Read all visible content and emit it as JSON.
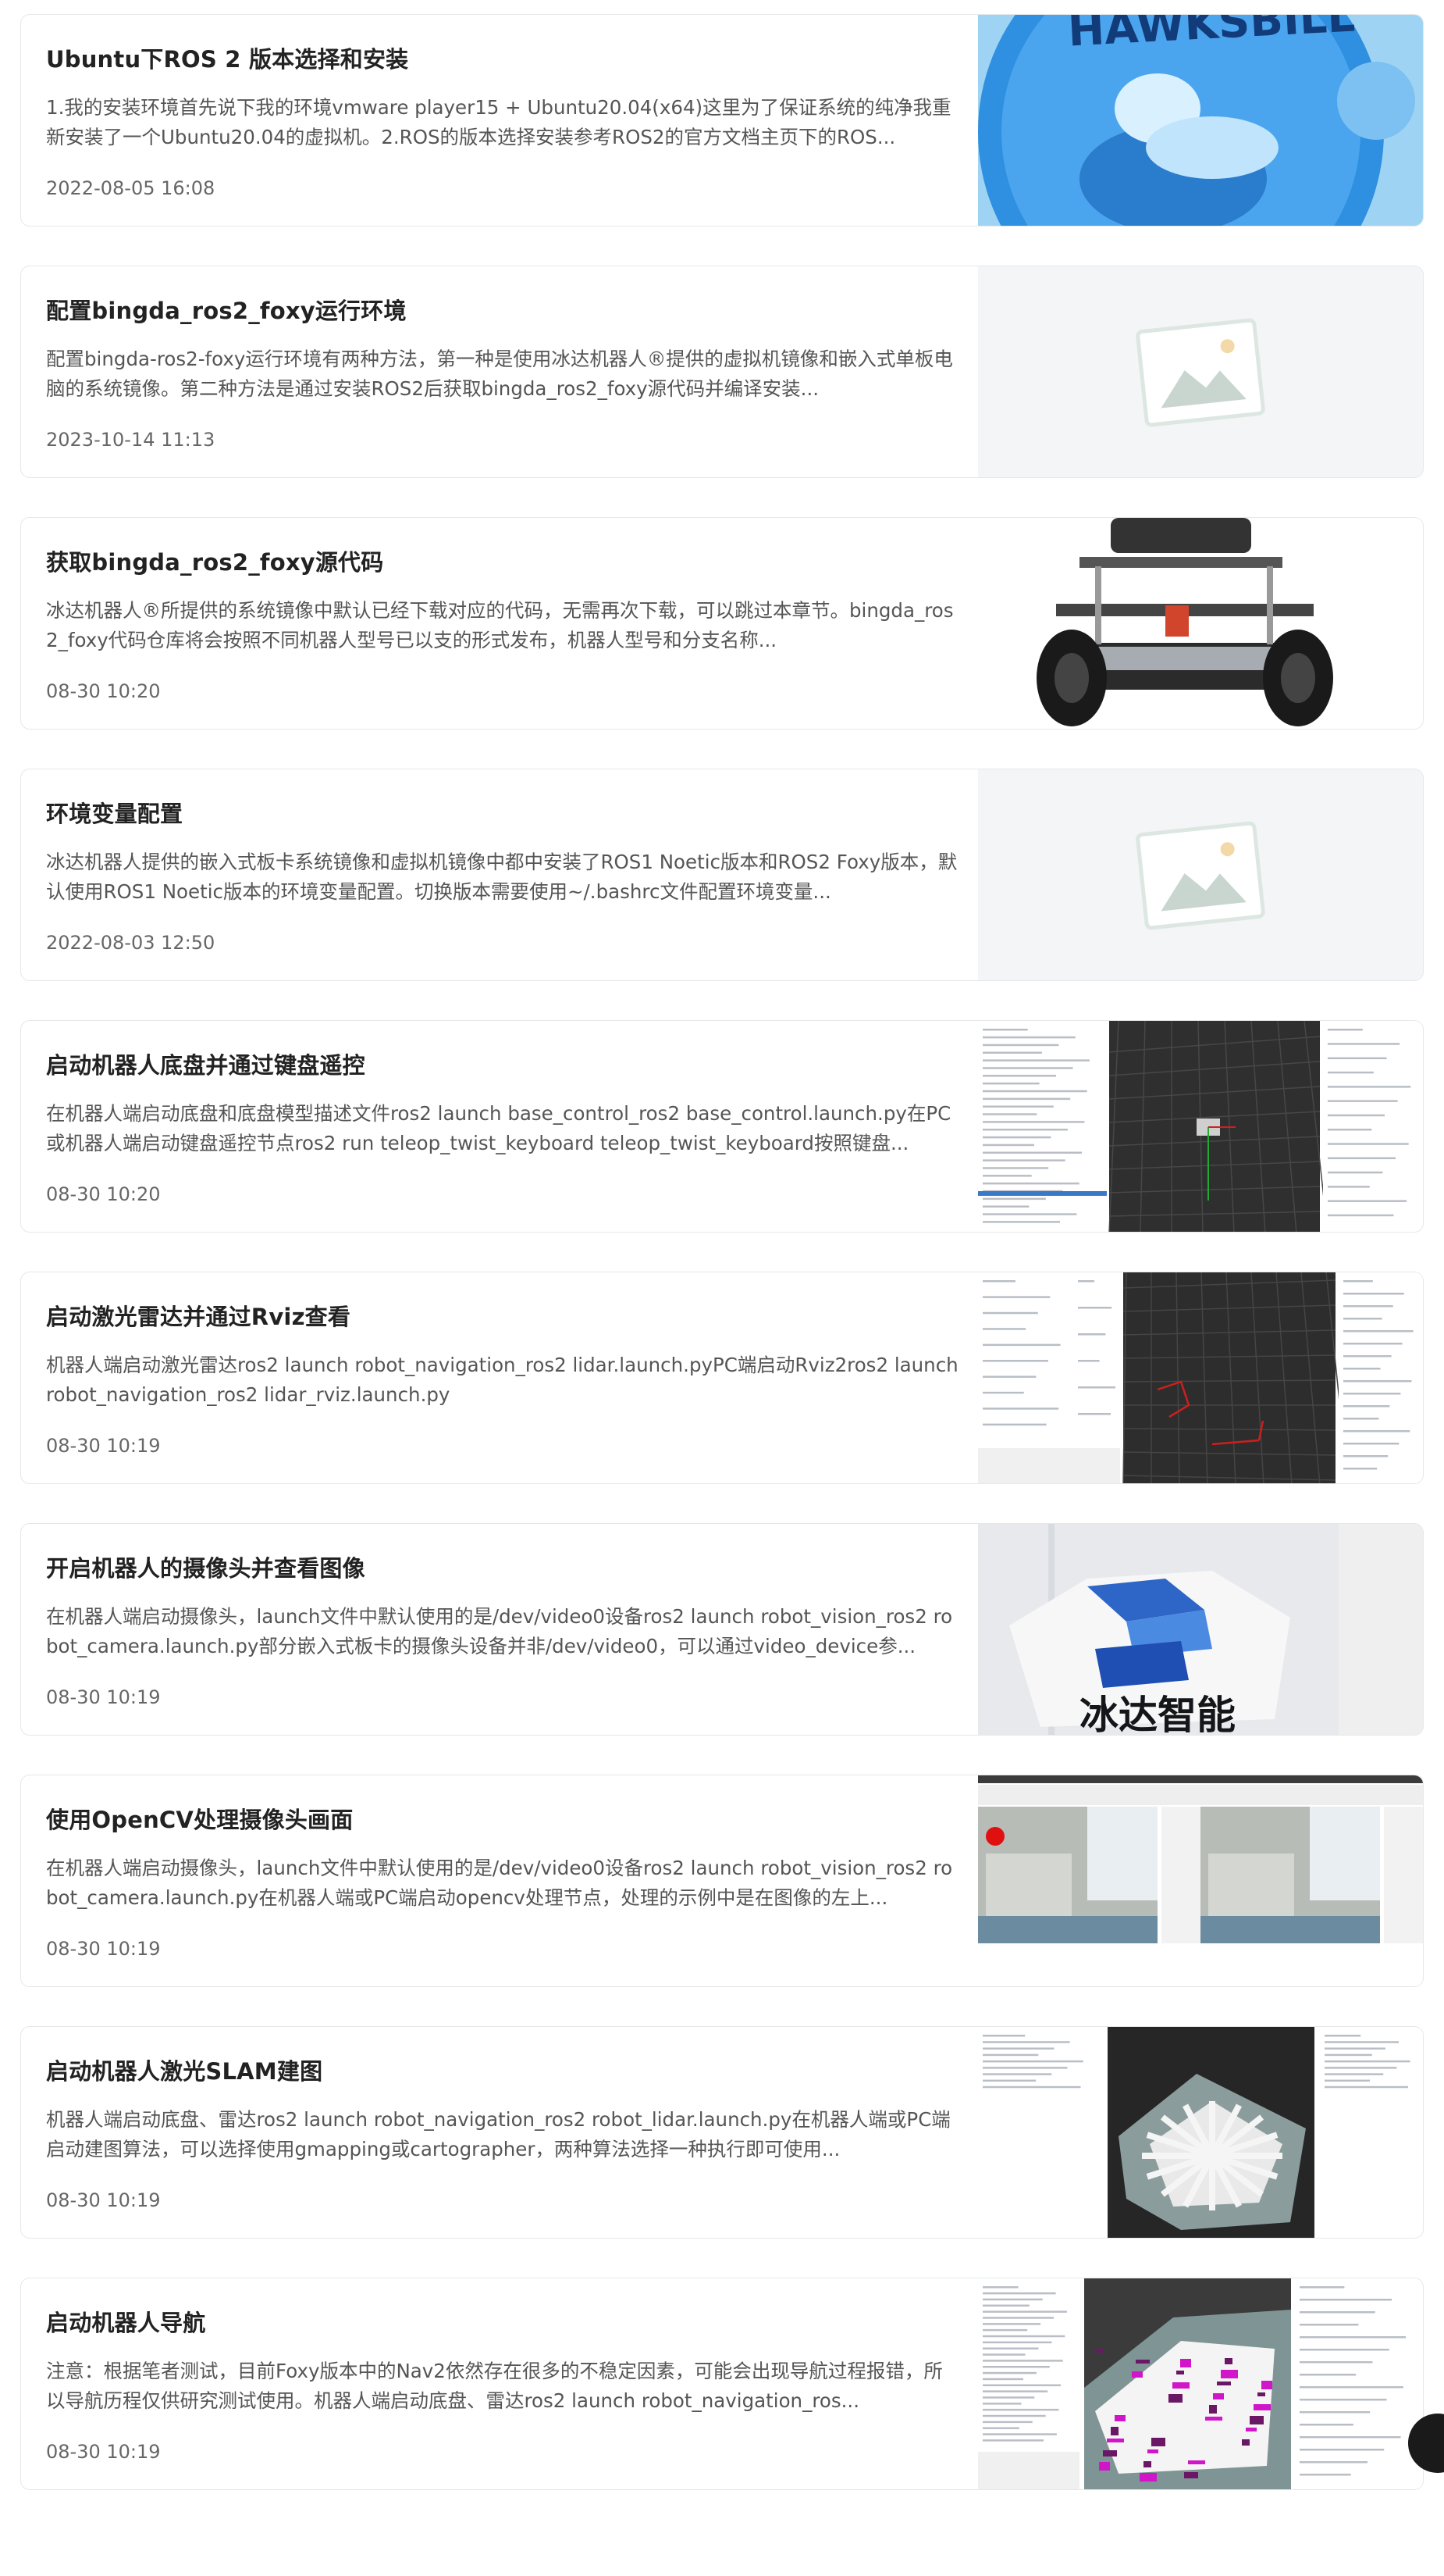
{
  "articles": [
    {
      "title": "Ubuntu下ROS 2 版本选择和安装",
      "desc": "1.我的安装环境首先说下我的环境vmware player15 + Ubuntu20.04(x64)这里为了保证系统的纯净我重新安装了一个Ubuntu20.04的虚拟机。2.ROS的版本选择安装参考ROS2的官方文档主页下的ROS...",
      "date": "2022-08-05 16:08",
      "thumb": "hawksbill",
      "thumb_text": "HAWKSBILL"
    },
    {
      "title": "配置bingda_ros2_foxy运行环境",
      "desc": "配置bingda-ros2-foxy运行环境有两种方法，第一种是使用冰达机器人®提供的虚拟机镜像和嵌入式单板电脑的系统镜像。第二种方法是通过安装ROS2后获取bingda_ros2_foxy源代码并编译安装...",
      "date": "2023-10-14 11:13",
      "thumb": "placeholder"
    },
    {
      "title": "获取bingda_ros2_foxy源代码",
      "desc": "冰达机器人®所提供的系统镜像中默认已经下载对应的代码，无需再次下载，可以跳过本章节。bingda_ros2_foxy代码仓库将会按照不同机器人型号已以支的形式发布，机器人型号和分支名称...",
      "date": "08-30 10:20",
      "thumb": "robot"
    },
    {
      "title": "环境变量配置",
      "desc": "冰达机器人提供的嵌入式板卡系统镜像和虚拟机镜像中都中安装了ROS1 Noetic版本和ROS2 Foxy版本，默认使用ROS1 Noetic版本的环境变量配置。切换版本需要使用~/.bashrc文件配置环境变量...",
      "date": "2022-08-03 12:50",
      "thumb": "placeholder"
    },
    {
      "title": "启动机器人底盘并通过键盘遥控",
      "desc": "在机器人端启动底盘和底盘模型描述文件ros2 launch base_control_ros2 base_control.launch.py在PC或机器人端启动键盘遥控节点ros2 run teleop_twist_keyboard teleop_twist_keyboard按照键盘...",
      "date": "08-30 10:20",
      "thumb": "rviz-robot"
    },
    {
      "title": "启动激光雷达并通过Rviz查看",
      "desc": "机器人端启动激光雷达ros2 launch robot_navigation_ros2 lidar.launch.pyPC端启动Rviz2ros2 launch robot_navigation_ros2 lidar_rviz.launch.py",
      "date": "08-30 10:19",
      "thumb": "rviz-lidar"
    },
    {
      "title": "开启机器人的摄像头并查看图像",
      "desc": "在机器人端启动摄像头，launch文件中默认使用的是/dev/video0设备ros2 launch robot_vision_ros2 robot_camera.launch.py部分嵌入式板卡的摄像头设备并非/dev/video0，可以通过video_device参...",
      "date": "08-30 10:19",
      "thumb": "camera",
      "thumb_text": "冰达智能"
    },
    {
      "title": "使用OpenCV处理摄像头画面",
      "desc": "在机器人端启动摄像头，launch文件中默认使用的是/dev/video0设备ros2 launch robot_vision_ros2 robot_camera.launch.py在机器人端或PC端启动opencv处理节点，处理的示例中是在图像的左上...",
      "date": "08-30 10:19",
      "thumb": "opencv"
    },
    {
      "title": "启动机器人激光SLAM建图",
      "desc": "机器人端启动底盘、雷达ros2 launch robot_navigation_ros2 robot_lidar.launch.py在机器人端或PC端启动建图算法，可以选择使用gmapping或cartographer，两种算法选择一种执行即可使用...",
      "date": "08-30 10:19",
      "thumb": "slam"
    },
    {
      "title": "启动机器人导航",
      "desc": "注意：根据笔者测试，目前Foxy版本中的Nav2依然存在很多的不稳定因素，可能会出现导航过程报错，所以导航历程仅供研究测试使用。机器人端启动底盘、雷达ros2 launch robot_navigation_ros...",
      "date": "08-30 10:19",
      "thumb": "nav"
    }
  ]
}
